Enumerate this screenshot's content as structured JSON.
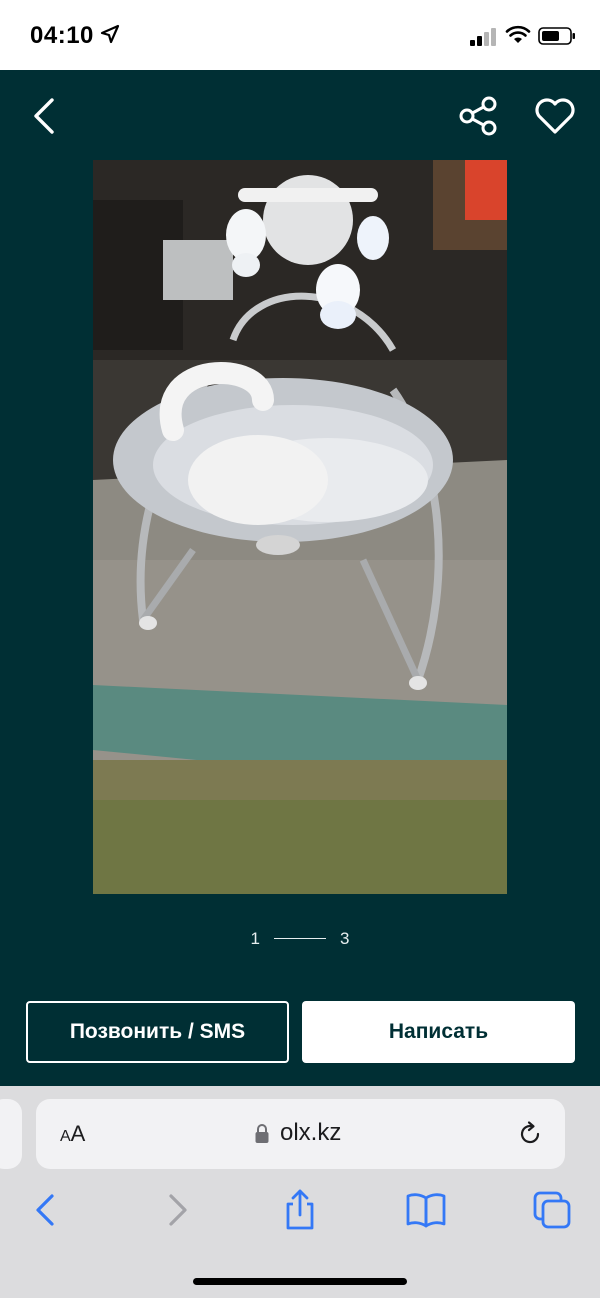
{
  "status_bar": {
    "time": "04:10",
    "icons": [
      "location-arrow-icon",
      "cellular-signal-icon",
      "wifi-icon",
      "battery-icon"
    ]
  },
  "header": {
    "icons": [
      "back-chevron-icon",
      "share-icon",
      "heart-icon"
    ]
  },
  "gallery": {
    "current_index": "1",
    "total": "3",
    "image_subject": "baby swing"
  },
  "actions": {
    "call_label": "Позвонить / SMS",
    "write_label": "Написать"
  },
  "browser": {
    "text_size_small": "A",
    "text_size_large": "A",
    "url": "olx.kz",
    "toolbar_icons": [
      "back-icon",
      "forward-icon",
      "share-icon",
      "bookmarks-icon",
      "tabs-icon"
    ]
  },
  "colors": {
    "app_background": "#002f34",
    "accent_white": "#ffffff",
    "safari_blue": "#3478f6",
    "browser_bar": "#dcdcde"
  }
}
